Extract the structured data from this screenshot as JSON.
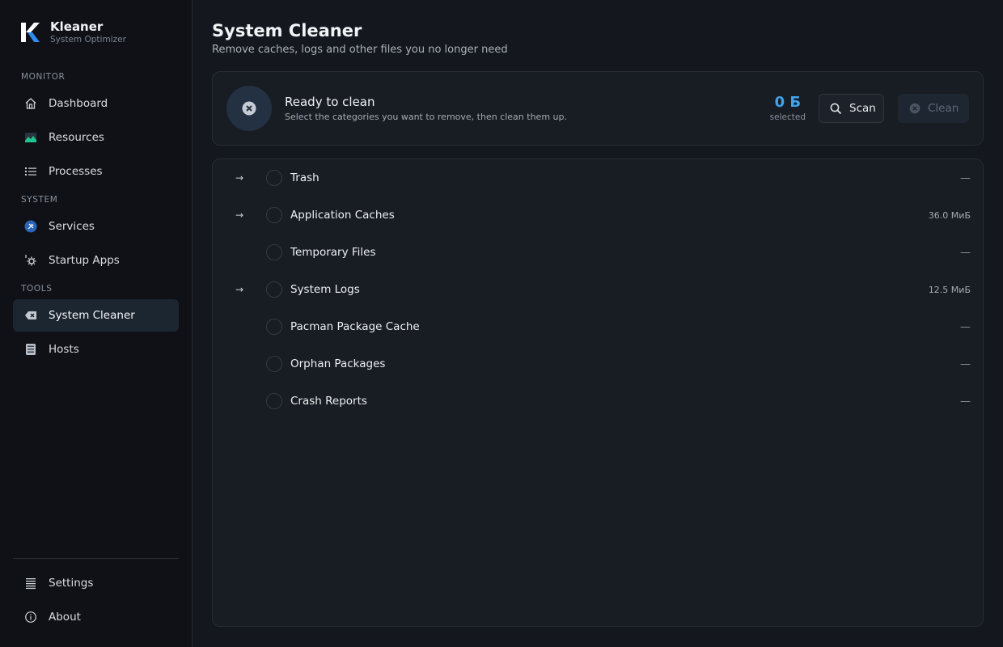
{
  "brand": {
    "name": "Kleaner",
    "subtitle": "System Optimizer"
  },
  "sidebar": {
    "sections": [
      {
        "label": "MONITOR",
        "items": [
          {
            "label": "Dashboard",
            "icon": "home-icon"
          },
          {
            "label": "Resources",
            "icon": "image-icon"
          },
          {
            "label": "Processes",
            "icon": "list-icon"
          }
        ]
      },
      {
        "label": "SYSTEM",
        "items": [
          {
            "label": "Services",
            "icon": "tools-icon"
          },
          {
            "label": "Startup Apps",
            "icon": "gear-icon"
          }
        ]
      },
      {
        "label": "TOOLS",
        "items": [
          {
            "label": "System Cleaner",
            "icon": "backspace-icon",
            "active": true
          },
          {
            "label": "Hosts",
            "icon": "server-icon"
          }
        ]
      }
    ],
    "bottom": [
      {
        "label": "Settings",
        "icon": "menu-icon"
      },
      {
        "label": "About",
        "icon": "info-icon"
      }
    ]
  },
  "page": {
    "title": "System Cleaner",
    "subtitle": "Remove caches, logs and other files you no longer need"
  },
  "status": {
    "title": "Ready to clean",
    "description": "Select the categories you want to remove, then clean them up.",
    "selected_value": "0 Б",
    "selected_label": "selected",
    "scan_label": "Scan",
    "clean_label": "Clean"
  },
  "categories": [
    {
      "name": "Trash",
      "size": "—",
      "expandable": true
    },
    {
      "name": "Application Caches",
      "size": "36.0 МиБ",
      "expandable": true
    },
    {
      "name": "Temporary Files",
      "size": "—",
      "expandable": false
    },
    {
      "name": "System Logs",
      "size": "12.5 МиБ",
      "expandable": true
    },
    {
      "name": "Pacman Package Cache",
      "size": "—",
      "expandable": false
    },
    {
      "name": "Orphan Packages",
      "size": "—",
      "expandable": false
    },
    {
      "name": "Crash Reports",
      "size": "—",
      "expandable": false
    }
  ],
  "colors": {
    "accent": "#3fa3f0",
    "active_bg": "#1c2631",
    "brand_blue": "#2f8cf0"
  }
}
